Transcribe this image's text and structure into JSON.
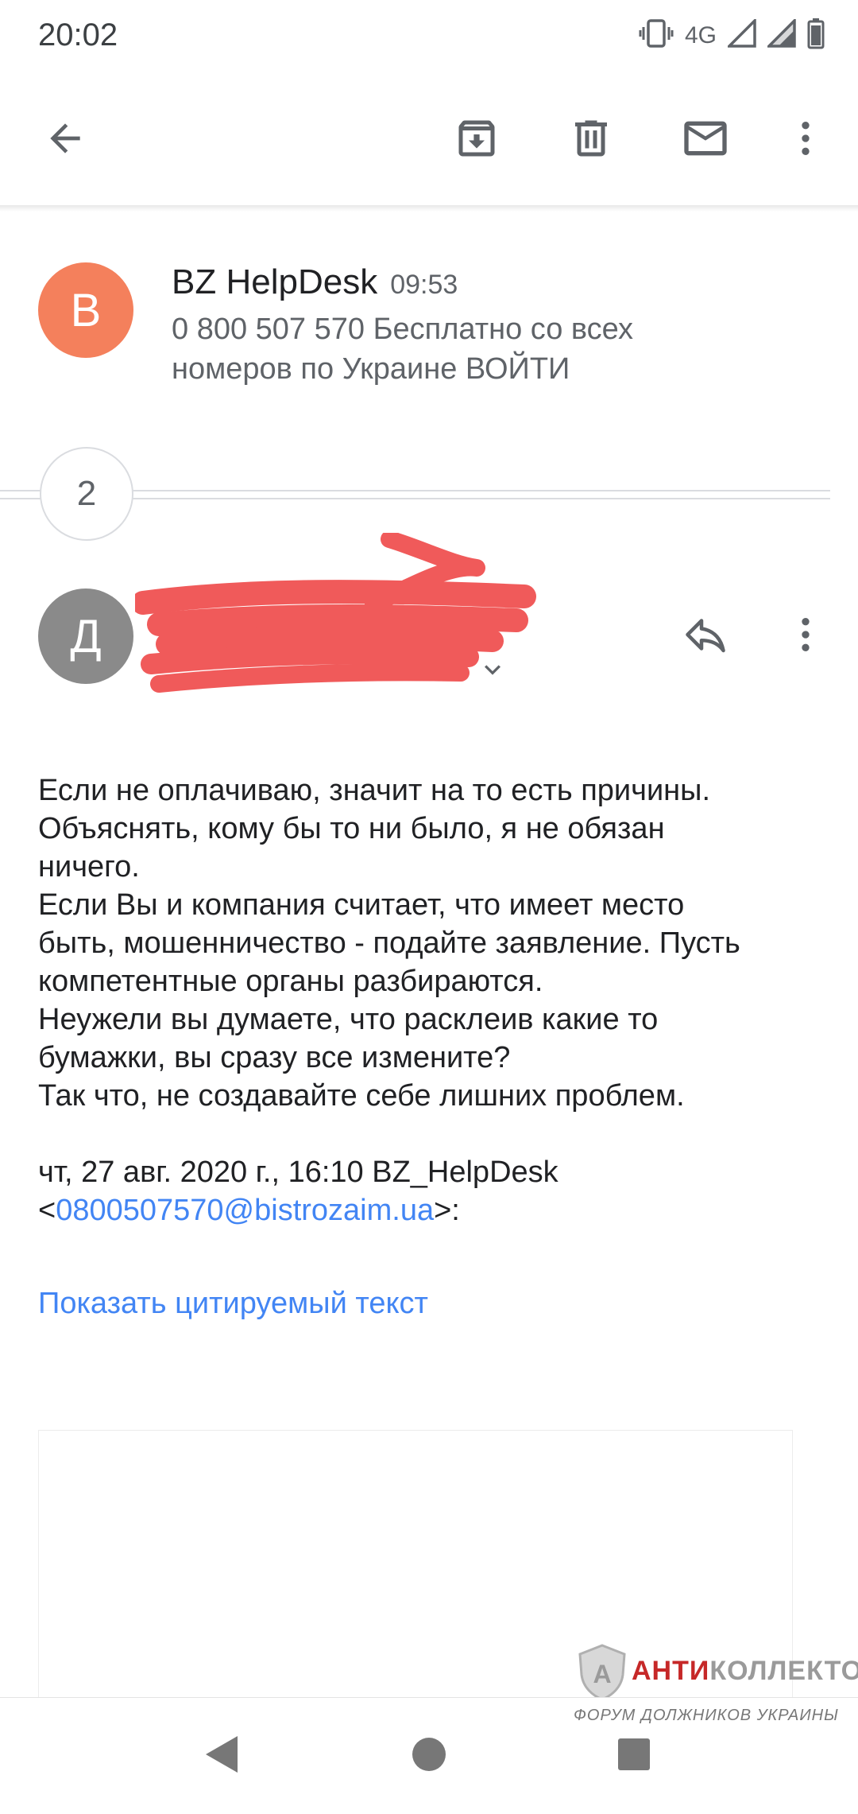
{
  "status_bar": {
    "time": "20:02",
    "network": "4G",
    "icons": [
      "vibrate-icon",
      "signal-icon",
      "signal-icon",
      "battery-icon"
    ]
  },
  "toolbar": {
    "back_icon": "arrow-left-icon",
    "archive_icon": "archive-icon",
    "delete_icon": "trash-icon",
    "mark_unread_icon": "mail-icon",
    "more_icon": "more-vert-icon"
  },
  "message1": {
    "avatar_letter": "B",
    "avatar_color": "#f4805c",
    "sender": "BZ HelpDesk",
    "time": "09:53",
    "snippet_line1": "0 800 507 570 Бесплатно со всех",
    "snippet_line2": "номеров по Украине ВОЙТИ"
  },
  "collapsed": {
    "count": "2"
  },
  "message2": {
    "avatar_letter": "Д",
    "avatar_color": "#8a8a8a",
    "reply_icon": "reply-icon",
    "more_icon": "more-vert-icon",
    "expand_icon": "chevron-down-icon",
    "redaction_color": "#f05a5a",
    "body": [
      "Если не оплачиваю, значит на то есть причины.",
      "Объяснять, кому бы то ни было, я не обязан",
      "ничего.",
      "Если Вы и компания считает, что имеет место",
      "быть, мошенничество - подайте заявление. Пусть",
      "компетентные органы разбираются.",
      "Неужели вы думаете, что расклеив какие то",
      "бумажки, вы сразу все измените?",
      "Так что, не создавайте себе лишних проблем."
    ],
    "quote_header_line1": "чт, 27 авг. 2020 г., 16:10 BZ_HelpDesk",
    "quote_open": "<",
    "quote_email": "0800507570@bistrozaim.ua",
    "quote_close": ">:",
    "show_quoted": "Показать цитируемый текст"
  },
  "watermark": {
    "title_red": "АНТИ",
    "title_rest": "КОЛЛЕКТОР",
    "subtitle": "ФОРУМ ДОЛЖНИКОВ УКРАИНЫ",
    "shield_letter": "А"
  },
  "nav_bar": {
    "back_icon": "nav-back-icon",
    "home_icon": "nav-home-icon",
    "recents_icon": "nav-recents-icon"
  }
}
